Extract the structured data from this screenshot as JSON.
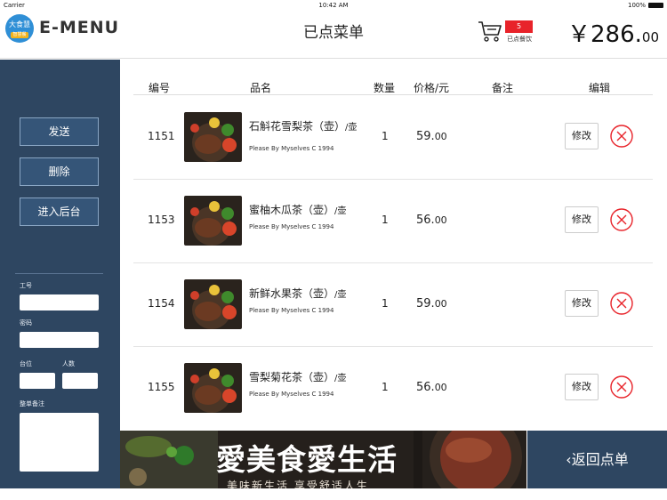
{
  "status_bar": {
    "carrier": "Carrier",
    "time": "10:42 AM",
    "battery": "100%"
  },
  "header": {
    "logo_text": "大食慧",
    "logo_sub": "智慧餐",
    "brand": "E-MENU",
    "title": "已点菜单",
    "cart_count": "5",
    "cart_label": "已点餐饮",
    "total_currency": "￥",
    "total_int": "286.",
    "total_dec": "00"
  },
  "sidebar": {
    "send_label": "发送",
    "delete_label": "删除",
    "backend_label": "进入后台",
    "employee_id_label": "工号",
    "password_label": "密码",
    "table_label": "台位",
    "guests_label": "人数",
    "order_note_label": "整单备注"
  },
  "table": {
    "headers": {
      "id": "编号",
      "name": "品名",
      "qty": "数量",
      "price": "价格/元",
      "note": "备注",
      "edit": "编辑"
    },
    "rows": [
      {
        "id": "1151",
        "name": "石斛花雪梨茶（壶）",
        "unit": "/壶",
        "desc": "Please By Myselves C 1994",
        "qty": "1",
        "price_int": "59.",
        "price_dec": "00",
        "edit_label": "修改"
      },
      {
        "id": "1153",
        "name": "蜜柚木瓜茶（壶）",
        "unit": "/壶",
        "desc": "Please By Myselves C 1994",
        "qty": "1",
        "price_int": "56.",
        "price_dec": "00",
        "edit_label": "修改"
      },
      {
        "id": "1154",
        "name": "新鲜水果茶（壶）",
        "unit": "/壶",
        "desc": "Please By Myselves C 1994",
        "qty": "1",
        "price_int": "59.",
        "price_dec": "00",
        "edit_label": "修改"
      },
      {
        "id": "1155",
        "name": "雪梨菊花茶（壶）",
        "unit": "/壶",
        "desc": "Please By Myselves C 1994",
        "qty": "1",
        "price_int": "56.",
        "price_dec": "00",
        "edit_label": "修改"
      }
    ]
  },
  "banner": {
    "title": "愛美食愛生活",
    "subtitle": "美味新生活 享受舒适人生"
  },
  "back_button": {
    "label": "返回点单"
  },
  "colors": {
    "sidebar": "#2e4661",
    "accent_red": "#e8232a",
    "banner_bg": "#25201c"
  }
}
